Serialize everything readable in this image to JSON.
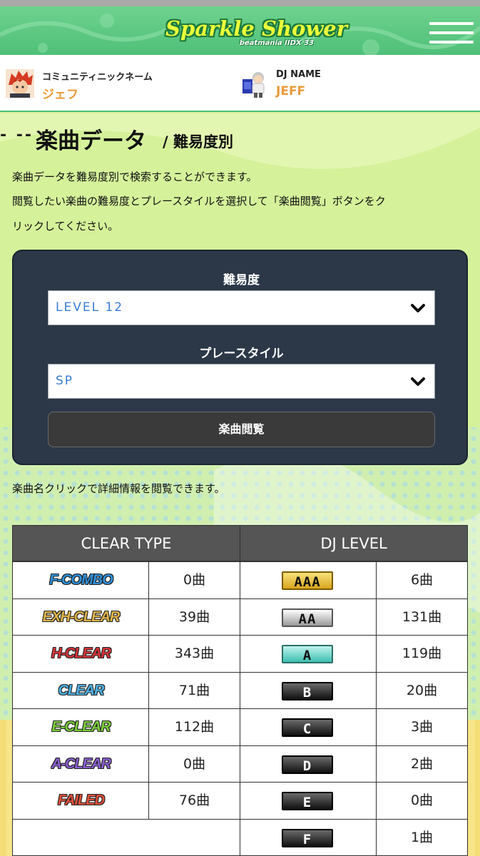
{
  "header": {
    "logo_title": "Sparkle Shower",
    "logo_subtitle": "beatmania IIDX 33",
    "menu_icon": "hamburger-menu-icon"
  },
  "profile": {
    "community_label": "コミュニティニックネーム",
    "community_name": "ジェフ",
    "dj_name_label": "DJ NAME",
    "dj_name": "JEFF"
  },
  "section": {
    "dashes": "- --",
    "title": "楽曲データ",
    "subtitle": "/ 難易度別"
  },
  "description": {
    "line1": "楽曲データを難易度別で検索することができます。",
    "line2": "閲覧したい楽曲の難易度とプレースタイルを選択して「楽曲閲覧」ボタンをク",
    "line3": "リックしてください。"
  },
  "form": {
    "difficulty_label": "難易度",
    "difficulty_value": "LEVEL 12",
    "style_label": "プレースタイル",
    "style_value": "SP",
    "submit_label": "楽曲閲覧"
  },
  "note": "楽曲名クリックで詳細情報を閲覧できます。",
  "table": {
    "clear_header": "CLEAR TYPE",
    "dj_header": "DJ LEVEL",
    "clear_rows": [
      {
        "label": "F-COMBO",
        "count": "0曲",
        "color": "#2f8fd8"
      },
      {
        "label": "EXH-CLEAR",
        "count": "39曲",
        "color": "#e0b44a"
      },
      {
        "label": "H-CLEAR",
        "count": "343曲",
        "color": "#d8353a"
      },
      {
        "label": "CLEAR",
        "count": "71曲",
        "color": "#4fb4e8"
      },
      {
        "label": "E-CLEAR",
        "count": "112曲",
        "color": "#7ccf3a"
      },
      {
        "label": "A-CLEAR",
        "count": "0曲",
        "color": "#8a5fd0"
      },
      {
        "label": "FAILED",
        "count": "76曲",
        "color": "#e0503a"
      }
    ],
    "dj_rows": [
      {
        "grade": "AAA",
        "count": "6曲",
        "style": "gold"
      },
      {
        "grade": "AA",
        "count": "131曲",
        "style": "silver"
      },
      {
        "grade": "A",
        "count": "119曲",
        "style": "teal"
      },
      {
        "grade": "B",
        "count": "20曲",
        "style": "black"
      },
      {
        "grade": "C",
        "count": "3曲",
        "style": "black"
      },
      {
        "grade": "D",
        "count": "2曲",
        "style": "black"
      },
      {
        "grade": "E",
        "count": "0曲",
        "style": "black"
      },
      {
        "grade": "F",
        "count": "1曲",
        "style": "black"
      }
    ]
  }
}
